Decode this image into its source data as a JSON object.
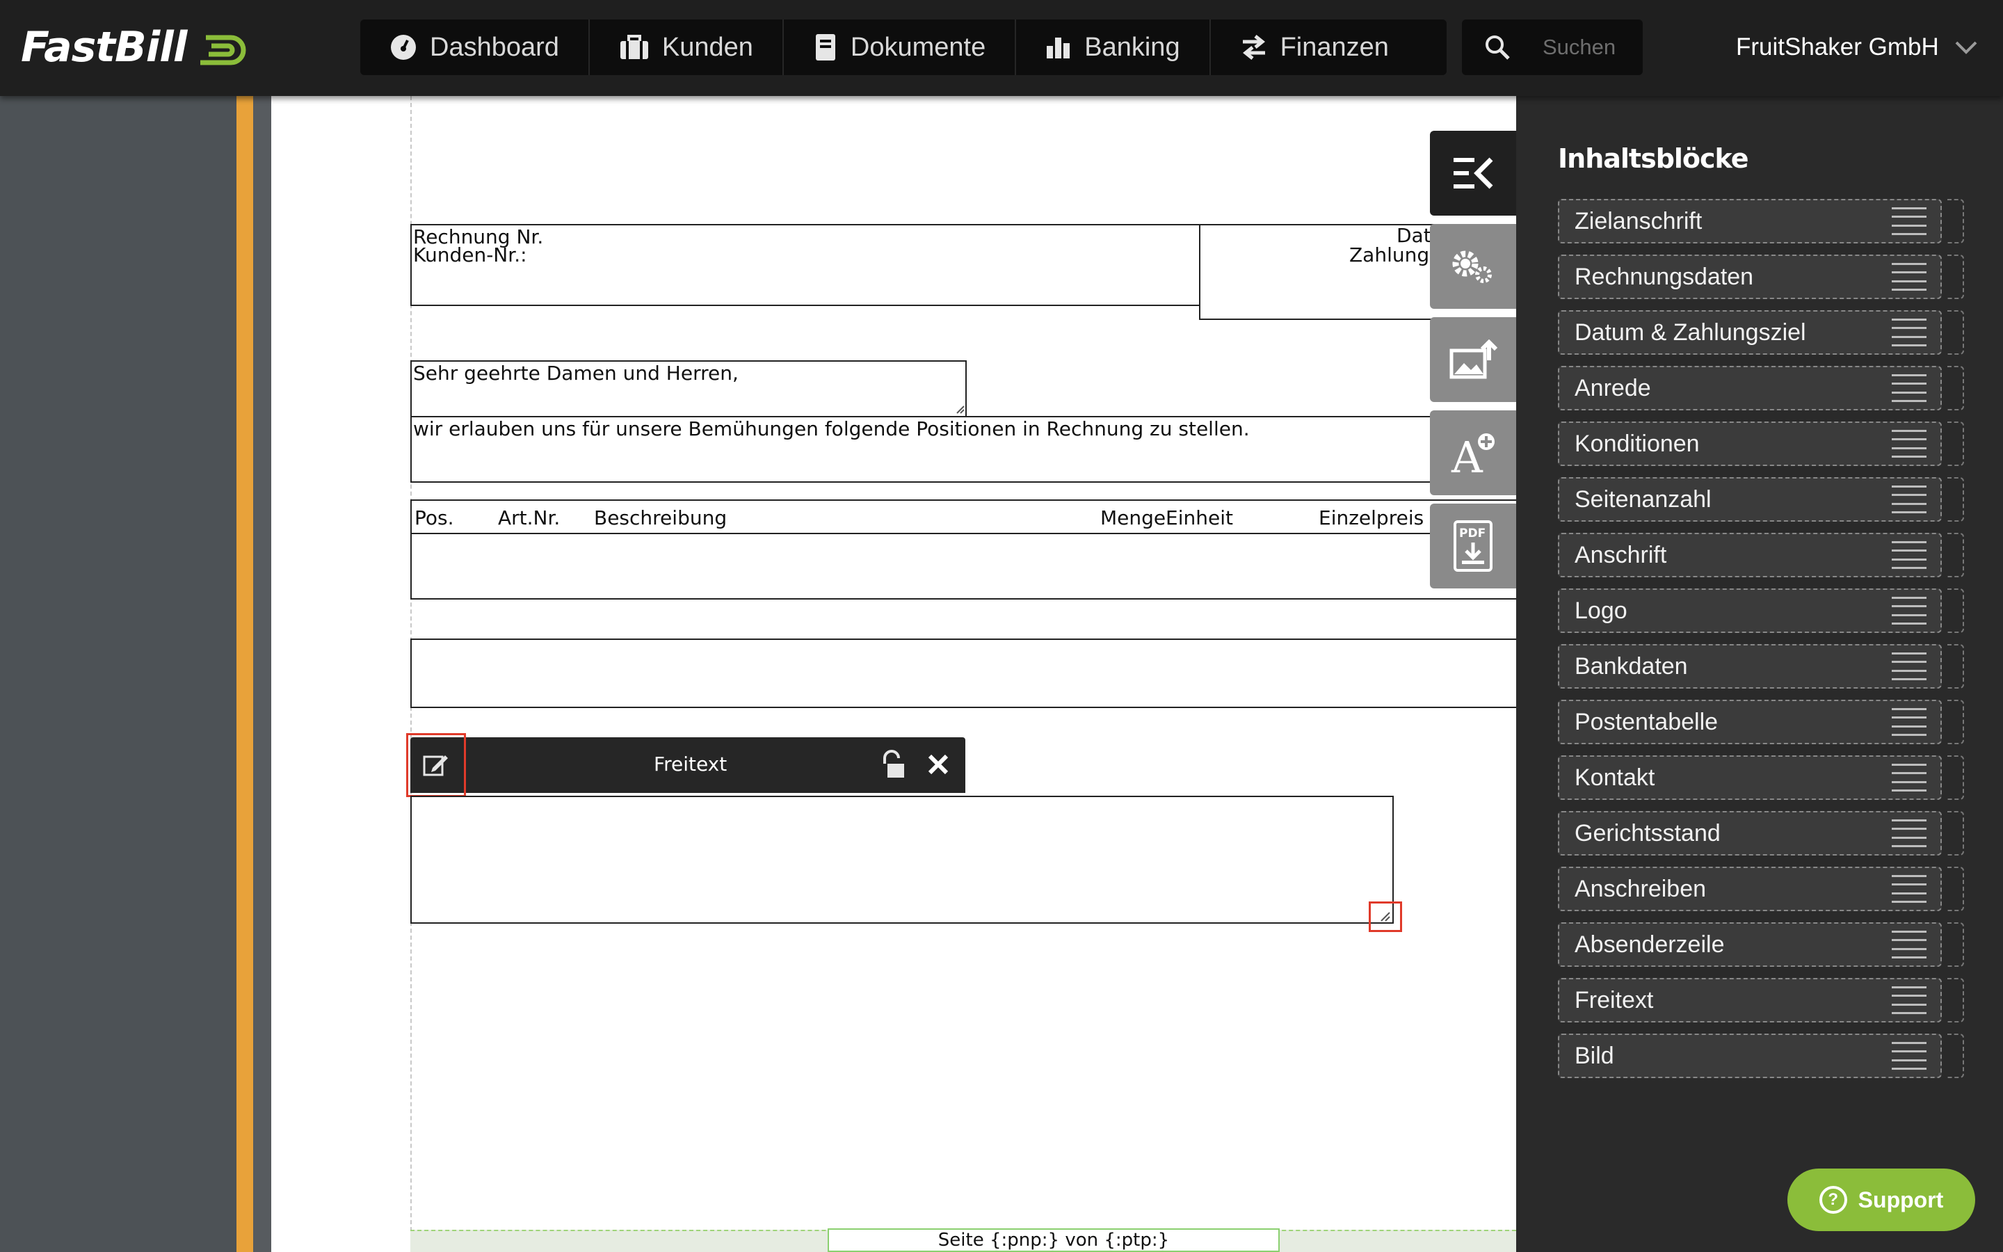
{
  "app": {
    "logo_text": "FastBill",
    "brand_color": "#8bbd3a",
    "accent_color": "#e8a23a"
  },
  "nav": {
    "items": [
      {
        "label": "Dashboard",
        "icon": "dashboard-gauge-icon"
      },
      {
        "label": "Kunden",
        "icon": "briefcase-icon"
      },
      {
        "label": "Dokumente",
        "icon": "document-icon"
      },
      {
        "label": "Banking",
        "icon": "bar-chart-icon"
      },
      {
        "label": "Finanzen",
        "icon": "transfer-arrows-icon"
      }
    ],
    "search_placeholder": "Suchen",
    "company": "FruitShaker GmbH"
  },
  "document": {
    "invoice_no_label": "Rechnung Nr.",
    "customer_no_label": "Kunden-Nr.:",
    "date_label_partial": "Dat",
    "payment_label_partial": "Zahlungs",
    "salutation": "Sehr geehrte Damen und Herren,",
    "intro": "wir erlauben uns für unsere Bemühungen folgende Positionen in Rechnung zu stellen.",
    "table_headers": [
      "Pos.",
      "Art.Nr.",
      "Beschreibung",
      "Menge",
      "Einheit",
      "Einzelpreis"
    ],
    "freitext_toolbar_title": "Freitext",
    "footer": "Seite {:pnp:} von {:ptp:}"
  },
  "tools": [
    {
      "name": "collapse-panel",
      "icon": "collapse-panel-icon"
    },
    {
      "name": "settings",
      "icon": "gears-icon"
    },
    {
      "name": "image-upload",
      "icon": "image-upload-icon"
    },
    {
      "name": "add-font",
      "icon": "add-font-icon"
    },
    {
      "name": "pdf-download",
      "icon": "pdf-download-icon"
    }
  ],
  "sidebar": {
    "title": "Inhaltsblöcke",
    "blocks": [
      "Zielanschrift",
      "Rechnungsdaten",
      "Datum & Zahlungsziel",
      "Anrede",
      "Konditionen",
      "Seitenanzahl",
      "Anschrift",
      "Logo",
      "Bankdaten",
      "Postentabelle",
      "Kontakt",
      "Gerichtsstand",
      "Anschreiben",
      "Absenderzeile",
      "Freitext",
      "Bild"
    ]
  },
  "support": {
    "label": "Support"
  }
}
